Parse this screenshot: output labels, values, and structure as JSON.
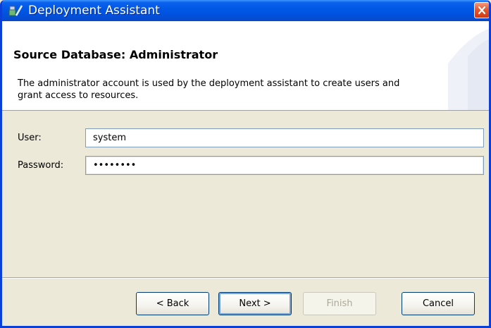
{
  "window": {
    "title": "Deployment Assistant",
    "icon": "deployment-assistant-icon",
    "close_icon": "close-icon"
  },
  "header": {
    "title": "Source Database: Administrator",
    "description": "The administrator account is used by the deployment assistant to create users and grant access to resources."
  },
  "form": {
    "user_label": "User:",
    "user_value": "system",
    "password_label": "Password:",
    "password_value": "********"
  },
  "buttons": {
    "back": "< Back",
    "next": "Next >",
    "finish": "Finish",
    "cancel": "Cancel"
  },
  "colors": {
    "title_bar": "#0058e6",
    "close_button": "#e3582f",
    "dialog_background": "#ece9d8"
  }
}
